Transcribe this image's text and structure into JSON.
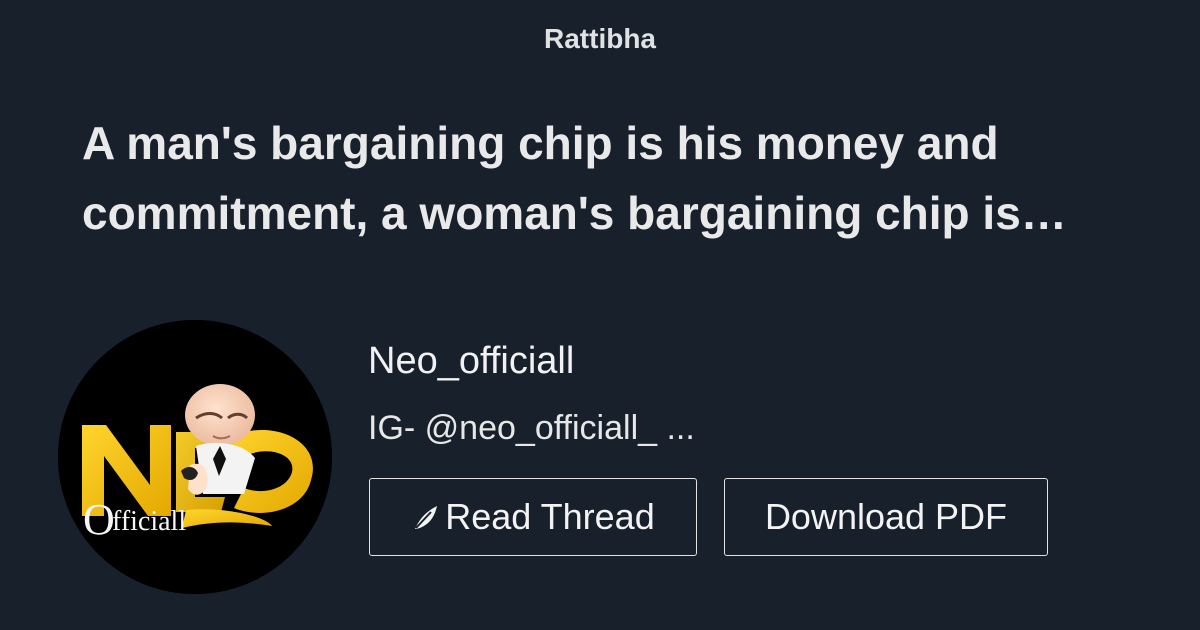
{
  "site": {
    "name": "Rattibha"
  },
  "thread": {
    "title_line1": "A man's bargaining chip is his money and",
    "title_line2": "commitment, a woman's bargaining chip is…"
  },
  "author": {
    "name": "Neo_officiall",
    "bio": "IG- @neo_officiall_ ...",
    "avatar": {
      "logo_text": "NEO",
      "logo_subtext": "Officiall",
      "colors": {
        "background": "#000000",
        "logo": "#f2c318"
      }
    }
  },
  "actions": {
    "read_thread_label": "Read Thread",
    "read_thread_icon": "feather-icon",
    "download_pdf_label": "Download PDF"
  },
  "colors": {
    "page_background": "#18202c",
    "text": "#ececec",
    "button_border": "#e2e2e2"
  }
}
